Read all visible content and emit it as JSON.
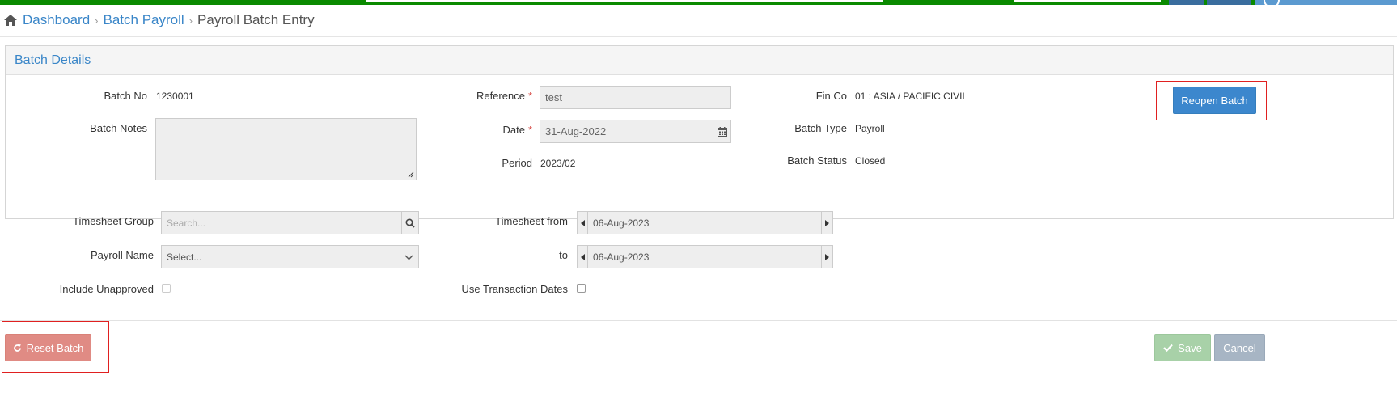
{
  "breadcrumb": {
    "items": [
      "Dashboard",
      "Batch Payroll"
    ],
    "current": "Payroll Batch Entry"
  },
  "panel": {
    "title": "Batch Details",
    "batch_no": {
      "label": "Batch No",
      "value": "1230001"
    },
    "batch_notes": {
      "label": "Batch Notes",
      "value": ""
    },
    "reference": {
      "label": "Reference",
      "required_mark": "*",
      "value": "test"
    },
    "date": {
      "label": "Date",
      "required_mark": "*",
      "value": "31-Aug-2022"
    },
    "period": {
      "label": "Period",
      "value": "2023/02"
    },
    "fin_co": {
      "label": "Fin Co",
      "value": "01 : ASIA / PACIFIC CIVIL"
    },
    "batch_type": {
      "label": "Batch Type",
      "value": "Payroll"
    },
    "batch_status": {
      "label": "Batch Status",
      "value": "Closed"
    },
    "reopen_label": "Reopen Batch"
  },
  "filters": {
    "timesheet_group": {
      "label": "Timesheet Group",
      "placeholder": "Search..."
    },
    "payroll_name": {
      "label": "Payroll Name",
      "placeholder": "Select..."
    },
    "include_unapproved": {
      "label": "Include Unapproved",
      "checked": false
    },
    "timesheet_from": {
      "label": "Timesheet from",
      "value": "06-Aug-2023"
    },
    "timesheet_to": {
      "label": "to",
      "value": "06-Aug-2023"
    },
    "use_transaction_dates": {
      "label": "Use Transaction Dates",
      "checked": false
    }
  },
  "footer": {
    "reset_label": "Reset Batch",
    "save_label": "Save",
    "cancel_label": "Cancel"
  },
  "colors": {
    "topbar": "#0a8a00",
    "link": "#3a86c8",
    "primary": "#3c87cd",
    "danger": "#e08b84",
    "success": "#a8d1a8",
    "highlight": "#e02020"
  }
}
